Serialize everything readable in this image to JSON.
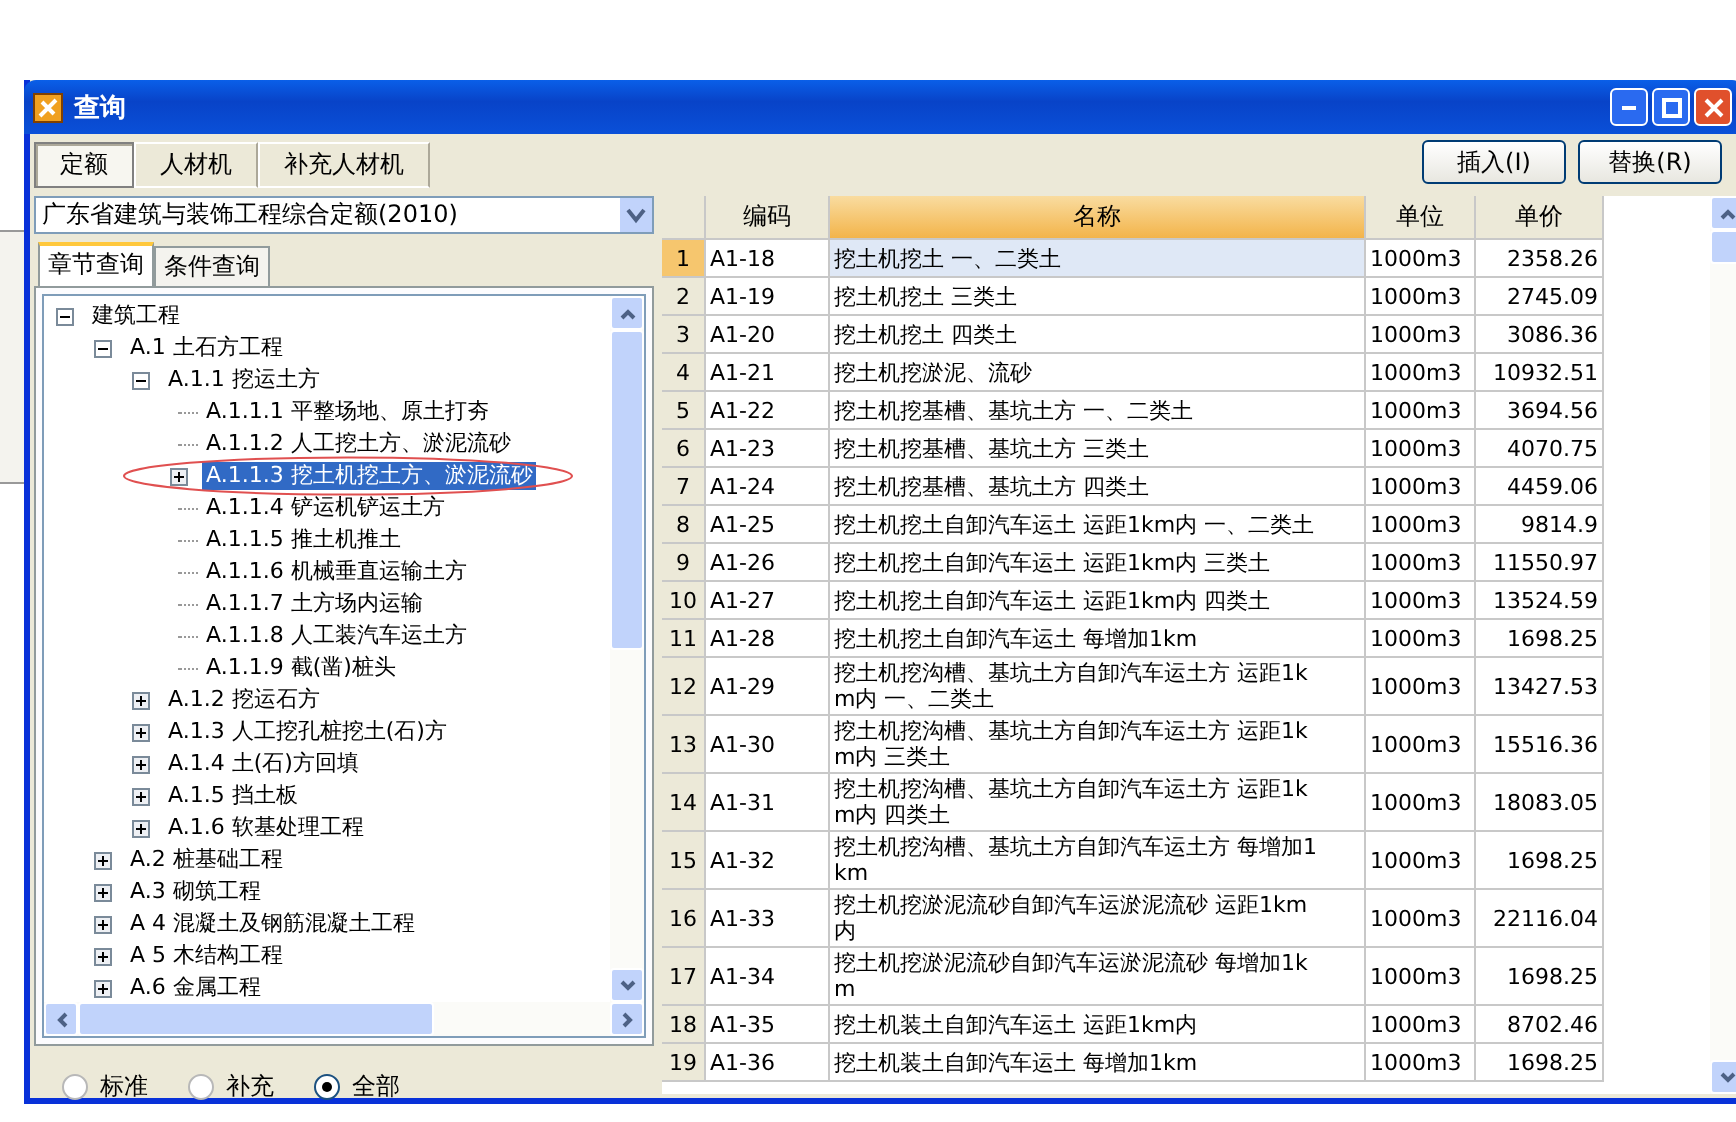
{
  "window": {
    "title": "查询"
  },
  "tabs": [
    {
      "label": "定额",
      "selected": true
    },
    {
      "label": "人材机",
      "selected": false
    },
    {
      "label": "补充人材机",
      "selected": false
    }
  ],
  "buttons": [
    "插入(I)",
    "替换(R)"
  ],
  "library_select": {
    "value": "广东省建筑与装饰工程综合定额(2010)"
  },
  "sub_tabs": [
    {
      "label": "章节查询",
      "selected": true
    },
    {
      "label": "条件查询",
      "selected": false
    }
  ],
  "tree": [
    {
      "label": "建筑工程",
      "kind": "branch",
      "expanded": true,
      "selected": false,
      "children": [
        {
          "label": "A.1 土石方工程",
          "kind": "branch",
          "expanded": true,
          "selected": false,
          "children": [
            {
              "label": "A.1.1 挖运土方",
              "kind": "branch",
              "expanded": true,
              "selected": false,
              "children": [
                {
                  "label": "A.1.1.1 平整场地、原土打夯",
                  "kind": "leaf",
                  "selected": false
                },
                {
                  "label": "A.1.1.2 人工挖土方、淤泥流砂",
                  "kind": "leaf",
                  "selected": false
                },
                {
                  "label": "A.1.1.3 挖土机挖土方、淤泥流砂",
                  "kind": "branch",
                  "expanded": false,
                  "selected": true
                },
                {
                  "label": "A.1.1.4 铲运机铲运土方",
                  "kind": "leaf",
                  "selected": false
                },
                {
                  "label": "A.1.1.5 推土机推土",
                  "kind": "leaf",
                  "selected": false
                },
                {
                  "label": "A.1.1.6 机械垂直运输土方",
                  "kind": "leaf",
                  "selected": false
                },
                {
                  "label": "A.1.1.7 土方场内运输",
                  "kind": "leaf",
                  "selected": false
                },
                {
                  "label": "A.1.1.8 人工装汽车运土方",
                  "kind": "leaf",
                  "selected": false
                },
                {
                  "label": "A.1.1.9 截(凿)桩头",
                  "kind": "leaf",
                  "selected": false
                }
              ]
            },
            {
              "label": "A.1.2 挖运石方",
              "kind": "branch",
              "expanded": false,
              "selected": false
            },
            {
              "label": "A.1.3 人工挖孔桩挖土(石)方",
              "kind": "branch",
              "expanded": false,
              "selected": false
            },
            {
              "label": "A.1.4 土(石)方回填",
              "kind": "branch",
              "expanded": false,
              "selected": false
            },
            {
              "label": "A.1.5 挡土板",
              "kind": "branch",
              "expanded": false,
              "selected": false
            },
            {
              "label": "A.1.6 软基处理工程",
              "kind": "branch",
              "expanded": false,
              "selected": false
            }
          ]
        },
        {
          "label": "A.2 桩基础工程",
          "kind": "branch",
          "expanded": false,
          "selected": false
        },
        {
          "label": "A.3 砌筑工程",
          "kind": "branch",
          "expanded": false,
          "selected": false
        },
        {
          "label": "A 4 混凝土及钢筋混凝土工程",
          "kind": "branch",
          "expanded": false,
          "selected": false
        },
        {
          "label": "A 5 木结构工程",
          "kind": "branch",
          "expanded": false,
          "selected": false
        },
        {
          "label": "A.6 金属工程",
          "kind": "branch",
          "expanded": false,
          "selected": false
        }
      ]
    }
  ],
  "filter": [
    {
      "label": "标准",
      "selected": false
    },
    {
      "label": "补充",
      "selected": false
    },
    {
      "label": "全部",
      "selected": true
    }
  ],
  "table": {
    "columns": [
      {
        "label": "编码",
        "selected": false
      },
      {
        "label": "名称",
        "selected": true
      },
      {
        "label": "单位",
        "selected": false
      },
      {
        "label": "单价",
        "selected": false
      }
    ],
    "rows": [
      {
        "no": "1",
        "code": "A1-18",
        "name": "挖土机挖土 一、二类土",
        "unit": "1000m3",
        "price": "2358.26",
        "selected": true
      },
      {
        "no": "2",
        "code": "A1-19",
        "name": "挖土机挖土 三类土",
        "unit": "1000m3",
        "price": "2745.09",
        "selected": false
      },
      {
        "no": "3",
        "code": "A1-20",
        "name": "挖土机挖土 四类土",
        "unit": "1000m3",
        "price": "3086.36",
        "selected": false
      },
      {
        "no": "4",
        "code": "A1-21",
        "name": "挖土机挖淤泥、流砂",
        "unit": "1000m3",
        "price": "10932.51",
        "selected": false
      },
      {
        "no": "5",
        "code": "A1-22",
        "name": "挖土机挖基槽、基坑土方 一、二类土",
        "unit": "1000m3",
        "price": "3694.56",
        "selected": false
      },
      {
        "no": "6",
        "code": "A1-23",
        "name": "挖土机挖基槽、基坑土方 三类土",
        "unit": "1000m3",
        "price": "4070.75",
        "selected": false
      },
      {
        "no": "7",
        "code": "A1-24",
        "name": "挖土机挖基槽、基坑土方 四类土",
        "unit": "1000m3",
        "price": "4459.06",
        "selected": false
      },
      {
        "no": "8",
        "code": "A1-25",
        "name": "挖土机挖土自卸汽车运土 运距1km内 一、二类土",
        "unit": "1000m3",
        "price": "9814.9",
        "selected": false
      },
      {
        "no": "9",
        "code": "A1-26",
        "name": "挖土机挖土自卸汽车运土 运距1km内 三类土",
        "unit": "1000m3",
        "price": "11550.97",
        "selected": false
      },
      {
        "no": "10",
        "code": "A1-27",
        "name": "挖土机挖土自卸汽车运土 运距1km内 四类土",
        "unit": "1000m3",
        "price": "13524.59",
        "selected": false
      },
      {
        "no": "11",
        "code": "A1-28",
        "name": "挖土机挖土自卸汽车运土 每增加1km",
        "unit": "1000m3",
        "price": "1698.25",
        "selected": false
      },
      {
        "no": "12",
        "code": "A1-29",
        "name": "挖土机挖沟槽、基坑土方自卸汽车运土方 运距1km内 一、二类土",
        "unit": "1000m3",
        "price": "13427.53",
        "selected": false
      },
      {
        "no": "13",
        "code": "A1-30",
        "name": "挖土机挖沟槽、基坑土方自卸汽车运土方 运距1km内 三类土",
        "unit": "1000m3",
        "price": "15516.36",
        "selected": false
      },
      {
        "no": "14",
        "code": "A1-31",
        "name": "挖土机挖沟槽、基坑土方自卸汽车运土方 运距1km内 四类土",
        "unit": "1000m3",
        "price": "18083.05",
        "selected": false
      },
      {
        "no": "15",
        "code": "A1-32",
        "name": "挖土机挖沟槽、基坑土方自卸汽车运土方 每增加1km",
        "unit": "1000m3",
        "price": "1698.25",
        "selected": false
      },
      {
        "no": "16",
        "code": "A1-33",
        "name": "挖土机挖淤泥流砂自卸汽车运淤泥流砂 运距1km内",
        "unit": "1000m3",
        "price": "22116.04",
        "selected": false
      },
      {
        "no": "17",
        "code": "A1-34",
        "name": "挖土机挖淤泥流砂自卸汽车运淤泥流砂 每增加1km",
        "unit": "1000m3",
        "price": "1698.25",
        "selected": false
      },
      {
        "no": "18",
        "code": "A1-35",
        "name": "挖土机装土自卸汽车运土 运距1km内",
        "unit": "1000m3",
        "price": "8702.46",
        "selected": false
      },
      {
        "no": "19",
        "code": "A1-36",
        "name": "挖土机装土自卸汽车运土 每增加1km",
        "unit": "1000m3",
        "price": "1698.25",
        "selected": false
      }
    ]
  }
}
